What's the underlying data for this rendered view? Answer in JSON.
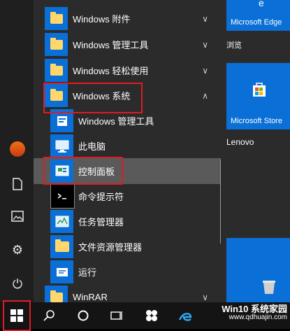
{
  "list": {
    "items": [
      {
        "label": "Windows 附件",
        "chev": "∨"
      },
      {
        "label": "Windows 管理工具",
        "chev": "∨"
      },
      {
        "label": "Windows 轻松使用",
        "chev": "∨"
      },
      {
        "label": "Windows 系统",
        "chev": "∧"
      },
      {
        "label": "Windows 管理工具"
      },
      {
        "label": "此电脑"
      },
      {
        "label": "控制面板"
      },
      {
        "label": "命令提示符"
      },
      {
        "label": "任务管理器"
      },
      {
        "label": "文件资源管理器"
      },
      {
        "label": "运行"
      },
      {
        "label": "WinRAR",
        "chev": "∨"
      }
    ]
  },
  "tiles": {
    "edge": "Microsoft Edge",
    "browse": "浏览",
    "store": "Microsoft Store",
    "lenovo": "Lenovo"
  },
  "watermark": {
    "line1": "Win10 系统家园",
    "line2": "www.qdhuajin.com"
  },
  "colors": {
    "accent": "#0a6fd6",
    "highlight": "#e01b24"
  }
}
